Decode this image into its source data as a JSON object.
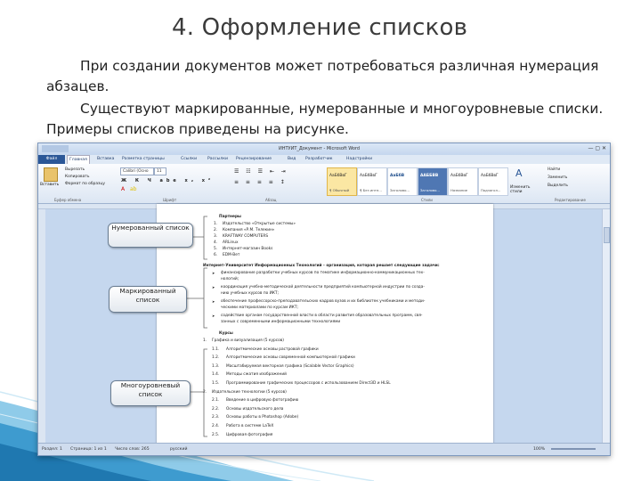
{
  "slide": {
    "title": "4. Оформление списков",
    "paragraph1": "При создании документов может потребоваться различная нумерация абзацев.",
    "paragraph2": "Существуют  маркированные, нумерованные и многоуровневые списки. Примеры списков приведены на рисунке."
  },
  "word": {
    "window_title": "ИНТУИТ_Документ - Microsoft Word",
    "tabs": [
      "Файл",
      "Главная",
      "Вставка",
      "Разметка страницы",
      "Ссылки",
      "Рассылки",
      "Рецензирование",
      "Вид",
      "Разработчик",
      "Надстройки"
    ],
    "active_tab": "Главная",
    "clipboard": {
      "paste": "Вставить",
      "cut": "Вырезать",
      "copy": "Копировать",
      "format_painter": "Формат по образцу",
      "label": "Буфер обмена"
    },
    "font": {
      "name": "Calibri (Осно",
      "size": "11",
      "label": "Шрифт",
      "format_row": "Ж К Ч abe x₂ x²"
    },
    "paragraph_group_label": "Абзац",
    "styles": [
      {
        "preview": "АаБбВвГ",
        "name": "¶ Обычный"
      },
      {
        "preview": "АаБбВвГ",
        "name": "¶ Без инте..."
      },
      {
        "preview": "АаБбВ",
        "name": "Заголово..."
      },
      {
        "preview": "ААББВВ",
        "name": "Заголово..."
      },
      {
        "preview": "АаБбВвГ",
        "name": "Название"
      },
      {
        "preview": "АаБбВвГ",
        "name": "Подзагол..."
      }
    ],
    "styles_label": "Стили",
    "change_styles": "Изменить стили",
    "editing": {
      "find": "Найти",
      "replace": "Заменить",
      "select": "Выделить",
      "label": "Редактирование"
    },
    "statusbar": {
      "page": "Раздел: 1",
      "pages": "Страница: 1 из 1",
      "words": "Число слов: 265",
      "lang": "русский",
      "zoom": "100%"
    }
  },
  "document": {
    "numbered_heading": "Партнеры",
    "numbered_items": [
      {
        "n": "1.",
        "text": "Издательство «Открытые системы»"
      },
      {
        "n": "2.",
        "text": "Компания «Р.М. Телекин»"
      },
      {
        "n": "3.",
        "text": "KRAFTWAY COMPUTERS"
      },
      {
        "n": "4.",
        "text": "ARLinux"
      },
      {
        "n": "5.",
        "text": "Интернет-магазин Books"
      },
      {
        "n": "6.",
        "text": "EDM-Вет"
      }
    ],
    "bulleted_heading": "Интернет-Университет Информационных Технологий - организация, которая решает следующие задачи:",
    "bulleted_items": [
      "финансирование разработки учебных курсов по тематике информационно-коммуникационных тех-",
      "нологий;",
      "координация учебно-методической деятельности предприятий компьютерной индустрии по созда-",
      "нию учебных курсов по ИКТ;",
      "обеспечение профессорско-преподавательских кадров вузов и их библиотек учебниками и методи-",
      "ческими материалами по курсам ИКТ;",
      "содействие органам государственной власти в области развития образовательных программ, свя-",
      "занных с современными информационными технологиями"
    ],
    "multilevel_heading": "Курсы",
    "multilevel_items": [
      {
        "n": "1.",
        "text": "Графика и визуализация (5 курсов)",
        "level": 1
      },
      {
        "n": "1.1.",
        "text": "Алгоритмические основы растровой графики",
        "level": 2
      },
      {
        "n": "1.2.",
        "text": "Алгоритмические основы современной компьютерной графики",
        "level": 2
      },
      {
        "n": "1.3.",
        "text": "Масштабируемая векторная графика (Scalable Vector Graphics)",
        "level": 2
      },
      {
        "n": "1.4.",
        "text": "Методы сжатия изображений",
        "level": 2
      },
      {
        "n": "1.5.",
        "text": "Программирование графических процессоров с использованием Direct3D и HLSL",
        "level": 2
      },
      {
        "n": "2.",
        "text": "Издательские технологии (5 курсов)",
        "level": 1
      },
      {
        "n": "2.1.",
        "text": "Введение в цифровую фотографию",
        "level": 2
      },
      {
        "n": "2.2.",
        "text": "Основы издательского дела",
        "level": 2
      },
      {
        "n": "2.3.",
        "text": "Основы работы в Photoshop (Adobe)",
        "level": 2
      },
      {
        "n": "2.4.",
        "text": "Работа в системе LaTeX",
        "level": 2
      },
      {
        "n": "2.5.",
        "text": "Цифровая фотография",
        "level": 2
      }
    ]
  },
  "callouts": {
    "numbered": "Нумерованный список",
    "bulleted": "Маркированный список",
    "multilevel": "Многоуровневый список"
  },
  "colors": {
    "wave_dark": "#2c8cc2",
    "wave_light": "#9fd3ee",
    "file_tab": "#2b5797"
  }
}
